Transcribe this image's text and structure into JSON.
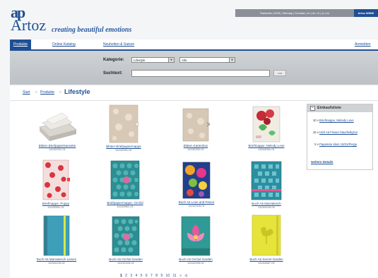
{
  "header": {
    "top_links": "Startseite | AGB | Sitemap | Kontakt | en | de | fr | pl | es",
    "top_brand": "Artoz WWW",
    "logo_mark": "ap",
    "logo_name": "Artoz",
    "tagline": "creating beautiful emotions"
  },
  "nav": {
    "products": "Produkte",
    "catalog": "Online Katalog",
    "news": "Neuheiten & Saison",
    "login": "Anmelden"
  },
  "filter": {
    "category_label": "Kategorie:",
    "category_value": "Lifestyle",
    "sub_value": "Alle",
    "search_label": "Suchtext:",
    "search_value": "",
    "search_button": "Los"
  },
  "breadcrumb": {
    "start": "Start",
    "products": "Produkte",
    "current": "Lifestyle",
    "arrow": "→"
  },
  "products": [
    {
      "title": "Blüten Briefpapierkassette",
      "sku": "14242202-01"
    },
    {
      "title": "Blüten Briefpapiermappe",
      "sku": "14242251-01"
    },
    {
      "title": "Blüten Kartenbox",
      "sku": "14242252-01"
    },
    {
      "title": "Briefmappe, Melody Love",
      "sku": "14244051-01"
    },
    {
      "title": "Briefmappe, Poppy",
      "sku": "14243551-01"
    },
    {
      "title": "Briefpapiermappe, Orchid",
      "sku": "14242851-01"
    },
    {
      "title": "Buch A6 Love and Peace",
      "sku": "14242928-01"
    },
    {
      "title": "Buch A5 Marrakesch",
      "sku": "14244109-04"
    },
    {
      "title": "Buch A5 Marrakesch Leinen",
      "sku": "14244109-02"
    },
    {
      "title": "Buch A5 Orchid Garden",
      "sku": "14242928-01"
    },
    {
      "title": "Buch A5 Orchid Garden",
      "sku": "14242928-02"
    },
    {
      "title": "Buch A5 Secret Garden",
      "sku": "14244587-02"
    }
  ],
  "cart": {
    "title": "Einkaufsliste",
    "items": [
      {
        "qty": "10 x",
        "name": "Briefmappe, Melody Love"
      },
      {
        "qty": "15 x",
        "name": "Heft A6 Flower blau/hellgrün"
      },
      {
        "qty": "5 x",
        "name": "Papeterie klein 10/01/Perga"
      }
    ],
    "more": "weitere Details"
  },
  "pager": {
    "current": "1",
    "pages": [
      "2",
      "3",
      "4",
      "5",
      "6",
      "7",
      "8",
      "9",
      "10",
      "11"
    ],
    "next": "»",
    "last": "»|"
  },
  "colors": {
    "brand": "#1f4f93",
    "filter_bar": "#c7cbce"
  }
}
